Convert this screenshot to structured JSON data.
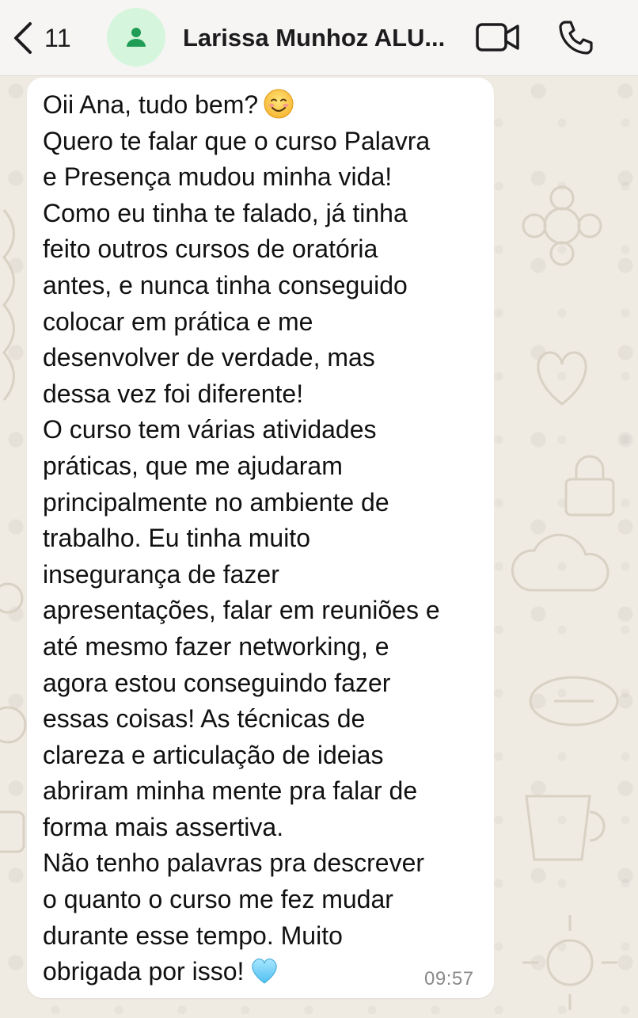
{
  "header": {
    "back_count": "11",
    "contact_name": "Larissa Munhoz ALU...",
    "icons": {
      "back": "chevron-left-icon",
      "avatar": "person-icon",
      "video": "video-camera-icon",
      "call": "phone-icon"
    }
  },
  "message": {
    "lines": [
      "Oii Ana, tudo bem?",
      "Quero te falar que o curso Palavra",
      "e Presença mudou minha vida!",
      "Como eu tinha te falado, já tinha",
      "feito outros cursos de oratória",
      "antes, e nunca tinha conseguido",
      "colocar em prática e me",
      "desenvolver de verdade, mas",
      "dessa vez foi diferente!",
      "O curso tem várias atividades",
      "práticas, que me ajudaram",
      "principalmente no ambiente de",
      "trabalho. Eu tinha muito",
      "insegurança de fazer",
      "apresentações, falar em reuniões e",
      "até mesmo fazer networking, e",
      "agora estou conseguindo fazer",
      "essas coisas! As técnicas de",
      "clareza e articulação de ideias",
      "abriram minha mente pra falar de",
      "forma mais assertiva.",
      "Não tenho palavras pra descrever",
      "o quanto o curso me fez mudar",
      "durante esse tempo. Muito",
      "obrigada por isso!"
    ],
    "emojis": {
      "first_line": "smiling-face-emoji",
      "last_line": "light-blue-heart-emoji"
    },
    "time": "09:57"
  },
  "colors": {
    "header_bg": "#f6f5f3",
    "chat_bg": "#efeae2",
    "bubble_bg": "#ffffff",
    "avatar_bg": "#d6f5dd",
    "avatar_icon": "#1f9d55",
    "text": "#111111",
    "timestamp": "#8a8a8a"
  }
}
